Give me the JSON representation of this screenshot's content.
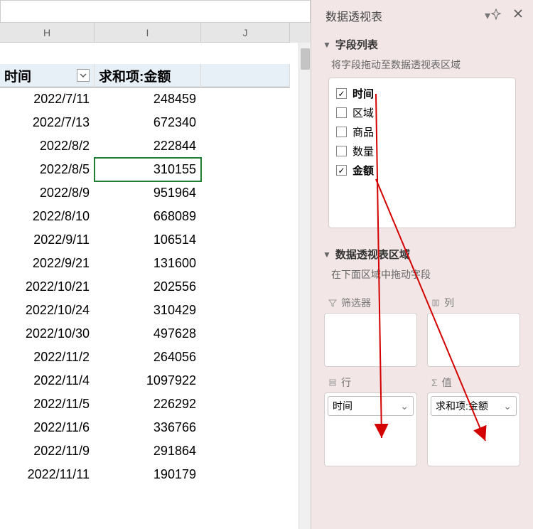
{
  "leftPane": {
    "columns": {
      "h": "H",
      "i": "I",
      "j": "J"
    },
    "headerRow": {
      "time": "时间",
      "value": "求和项:金额"
    },
    "rows": [
      {
        "time": "2022/7/11",
        "value": "248459"
      },
      {
        "time": "2022/7/13",
        "value": "672340"
      },
      {
        "time": "2022/8/2",
        "value": "222844"
      },
      {
        "time": "2022/8/5",
        "value": "310155",
        "selected": true
      },
      {
        "time": "2022/8/9",
        "value": "951964"
      },
      {
        "time": "2022/8/10",
        "value": "668089"
      },
      {
        "time": "2022/9/11",
        "value": "106514"
      },
      {
        "time": "2022/9/21",
        "value": "131600"
      },
      {
        "time": "2022/10/21",
        "value": "202556"
      },
      {
        "time": "2022/10/24",
        "value": "310429"
      },
      {
        "time": "2022/10/30",
        "value": "497628"
      },
      {
        "time": "2022/11/2",
        "value": "264056"
      },
      {
        "time": "2022/11/4",
        "value": "1097922"
      },
      {
        "time": "2022/11/5",
        "value": "226292"
      },
      {
        "time": "2022/11/6",
        "value": "336766"
      },
      {
        "time": "2022/11/9",
        "value": "291864"
      },
      {
        "time": "2022/11/11",
        "value": "190179"
      }
    ]
  },
  "rightPane": {
    "title": "数据透视表",
    "section1Title": "字段列表",
    "hint1": "将字段拖动至数据透视表区域",
    "fields": [
      {
        "label": "时间",
        "checked": true
      },
      {
        "label": "区域",
        "checked": false
      },
      {
        "label": "商品",
        "checked": false
      },
      {
        "label": "数量",
        "checked": false
      },
      {
        "label": "金额",
        "checked": true
      }
    ],
    "section2Title": "数据透视表区域",
    "hint2": "在下面区域中拖动字段",
    "areaLabels": {
      "filter": "筛选器",
      "column": "列",
      "row": "行",
      "value": "值"
    },
    "rowChip": "时间",
    "valueChip": "求和项:金额"
  }
}
